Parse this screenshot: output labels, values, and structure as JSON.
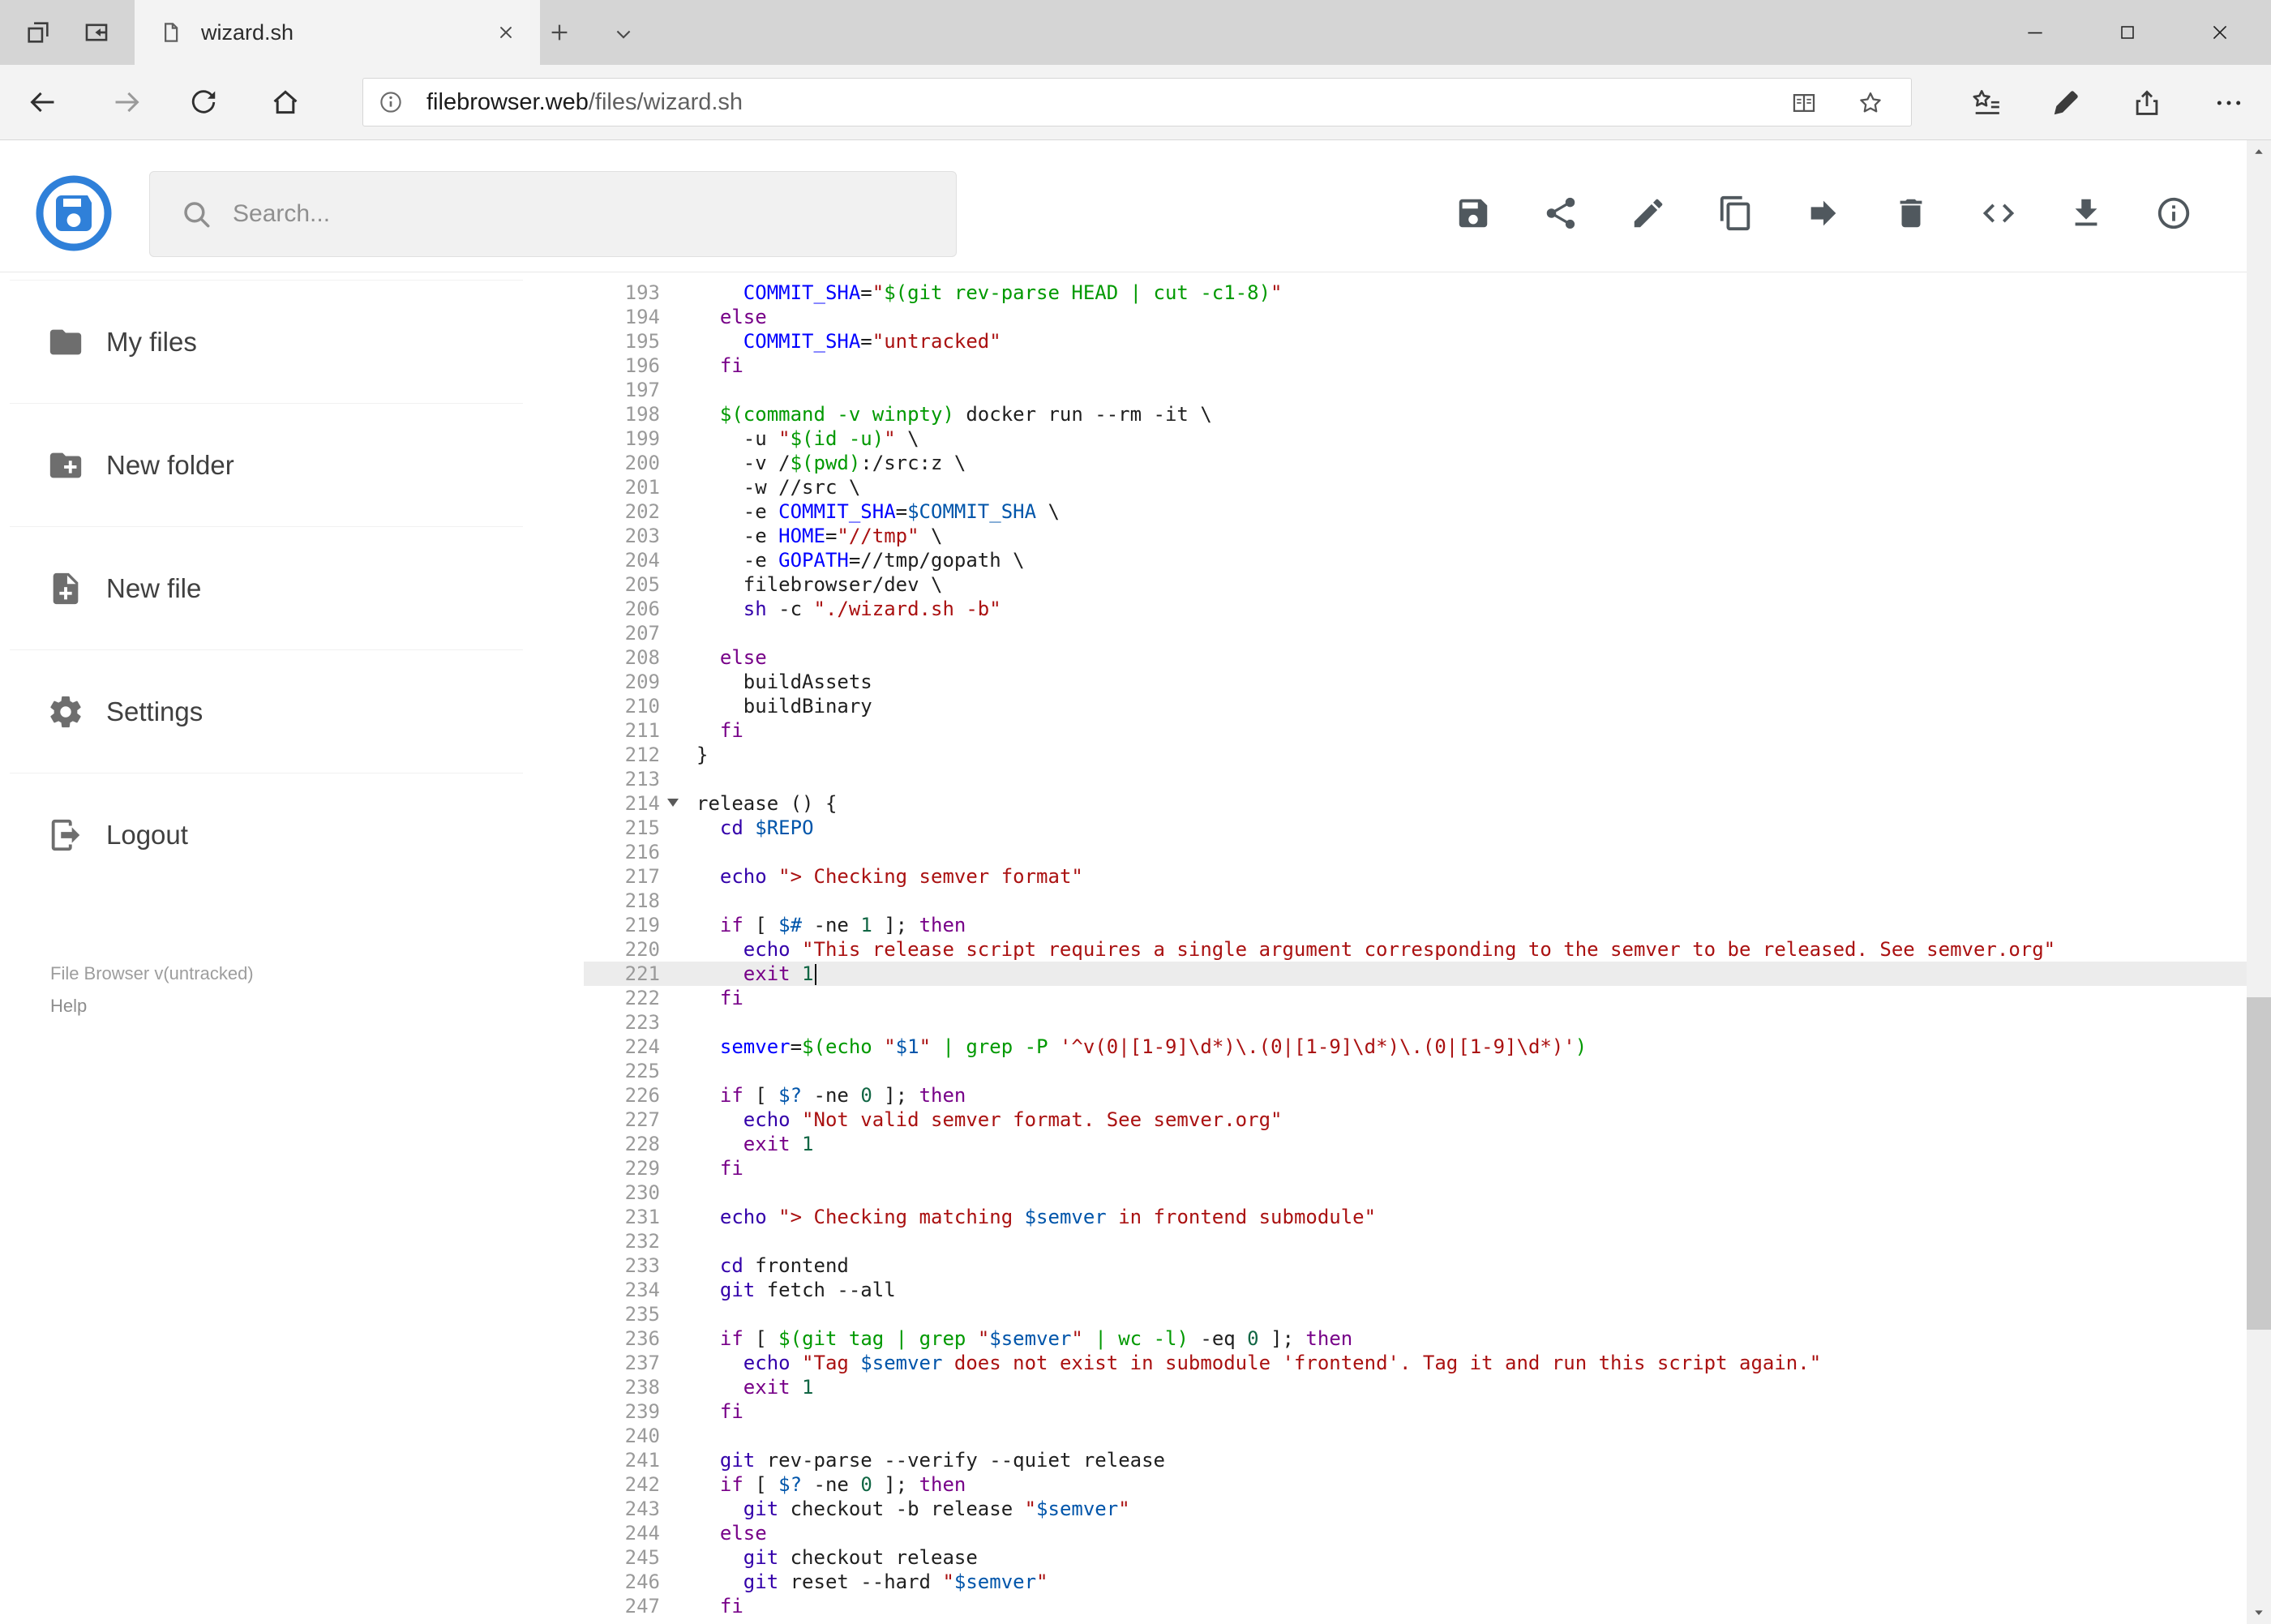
{
  "browser": {
    "tab_title": "wizard.sh",
    "url_domain": "filebrowser.web",
    "url_path": "/files/wizard.sh"
  },
  "header": {
    "search_placeholder": "Search...",
    "actions": [
      {
        "name": "save",
        "icon": "save-icon"
      },
      {
        "name": "share",
        "icon": "share-icon"
      },
      {
        "name": "edit",
        "icon": "edit-icon"
      },
      {
        "name": "copy",
        "icon": "copy-icon"
      },
      {
        "name": "move",
        "icon": "move-icon"
      },
      {
        "name": "delete",
        "icon": "delete-icon"
      },
      {
        "name": "code",
        "icon": "code-icon"
      },
      {
        "name": "download",
        "icon": "download-icon"
      },
      {
        "name": "info",
        "icon": "info-icon"
      }
    ]
  },
  "sidebar": {
    "items": [
      {
        "id": "my-files",
        "label": "My files",
        "icon": "folder-icon"
      },
      {
        "id": "new-folder",
        "label": "New folder",
        "icon": "folder-plus-icon"
      },
      {
        "id": "new-file",
        "label": "New file",
        "icon": "file-plus-icon"
      },
      {
        "id": "settings",
        "label": "Settings",
        "icon": "gear-icon"
      },
      {
        "id": "logout",
        "label": "Logout",
        "icon": "logout-icon"
      }
    ],
    "footer": {
      "version": "File Browser v(untracked)",
      "help": "Help"
    }
  },
  "colors": {
    "accent_blue": "#2f80d9",
    "active_line_bg": "#ececec",
    "syntax": {
      "keyword": "#770088",
      "builtin": "#3300aa",
      "string": "#aa1111",
      "variable": "#0055aa",
      "definition": "#0000ff",
      "quote": "#009900",
      "number": "#116644",
      "plain": "#1f1f1f",
      "line_number": "#9a9a9a"
    }
  },
  "editor": {
    "first_line": 193,
    "active_line": 221,
    "fold_line": 214,
    "lines": [
      {
        "n": 193,
        "t": [
          [
            "p",
            "    "
          ],
          [
            "d",
            "COMMIT_SHA"
          ],
          [
            "p",
            "="
          ],
          [
            "s",
            "\""
          ],
          [
            "q",
            "$(git rev-parse HEAD | cut -c1-8)"
          ],
          [
            "s",
            "\""
          ]
        ]
      },
      {
        "n": 194,
        "t": [
          [
            "p",
            "  "
          ],
          [
            "k",
            "else"
          ]
        ]
      },
      {
        "n": 195,
        "t": [
          [
            "p",
            "    "
          ],
          [
            "d",
            "COMMIT_SHA"
          ],
          [
            "p",
            "="
          ],
          [
            "s",
            "\"untracked\""
          ]
        ]
      },
      {
        "n": 196,
        "t": [
          [
            "p",
            "  "
          ],
          [
            "k",
            "fi"
          ]
        ]
      },
      {
        "n": 197,
        "t": []
      },
      {
        "n": 198,
        "t": [
          [
            "p",
            "  "
          ],
          [
            "q",
            "$(command -v winpty)"
          ],
          [
            "p",
            " docker run --rm -it \\"
          ]
        ]
      },
      {
        "n": 199,
        "t": [
          [
            "p",
            "    -u "
          ],
          [
            "s",
            "\""
          ],
          [
            "q",
            "$(id -u)"
          ],
          [
            "s",
            "\""
          ],
          [
            "p",
            " \\"
          ]
        ]
      },
      {
        "n": 200,
        "t": [
          [
            "p",
            "    -v /"
          ],
          [
            "q",
            "$(pwd)"
          ],
          [
            "p",
            ":/src:z \\"
          ]
        ]
      },
      {
        "n": 201,
        "t": [
          [
            "p",
            "    -w //src \\"
          ]
        ]
      },
      {
        "n": 202,
        "t": [
          [
            "p",
            "    -e "
          ],
          [
            "d",
            "COMMIT_SHA"
          ],
          [
            "p",
            "="
          ],
          [
            "v",
            "$COMMIT_SHA"
          ],
          [
            "p",
            " \\"
          ]
        ]
      },
      {
        "n": 203,
        "t": [
          [
            "p",
            "    -e "
          ],
          [
            "d",
            "HOME"
          ],
          [
            "p",
            "="
          ],
          [
            "s",
            "\"//tmp\""
          ],
          [
            "p",
            " \\"
          ]
        ]
      },
      {
        "n": 204,
        "t": [
          [
            "p",
            "    -e "
          ],
          [
            "d",
            "GOPATH"
          ],
          [
            "p",
            "=//tmp/gopath \\"
          ]
        ]
      },
      {
        "n": 205,
        "t": [
          [
            "p",
            "    filebrowser/dev \\"
          ]
        ]
      },
      {
        "n": 206,
        "t": [
          [
            "p",
            "    "
          ],
          [
            "b",
            "sh"
          ],
          [
            "p",
            " -c "
          ],
          [
            "s",
            "\"./wizard.sh -b\""
          ]
        ]
      },
      {
        "n": 207,
        "t": []
      },
      {
        "n": 208,
        "t": [
          [
            "p",
            "  "
          ],
          [
            "k",
            "else"
          ]
        ]
      },
      {
        "n": 209,
        "t": [
          [
            "p",
            "    buildAssets"
          ]
        ]
      },
      {
        "n": 210,
        "t": [
          [
            "p",
            "    buildBinary"
          ]
        ]
      },
      {
        "n": 211,
        "t": [
          [
            "p",
            "  "
          ],
          [
            "k",
            "fi"
          ]
        ]
      },
      {
        "n": 212,
        "t": [
          [
            "p",
            "}"
          ]
        ]
      },
      {
        "n": 213,
        "t": []
      },
      {
        "n": 214,
        "t": [
          [
            "p",
            "release () {"
          ]
        ]
      },
      {
        "n": 215,
        "t": [
          [
            "p",
            "  "
          ],
          [
            "b",
            "cd"
          ],
          [
            "p",
            " "
          ],
          [
            "v",
            "$REPO"
          ]
        ]
      },
      {
        "n": 216,
        "t": []
      },
      {
        "n": 217,
        "t": [
          [
            "p",
            "  "
          ],
          [
            "b",
            "echo"
          ],
          [
            "p",
            " "
          ],
          [
            "s",
            "\"> Checking semver format\""
          ]
        ]
      },
      {
        "n": 218,
        "t": []
      },
      {
        "n": 219,
        "t": [
          [
            "p",
            "  "
          ],
          [
            "k",
            "if"
          ],
          [
            "p",
            " [ "
          ],
          [
            "v",
            "$#"
          ],
          [
            "p",
            " -ne "
          ],
          [
            "n",
            "1"
          ],
          [
            "p",
            " ]; "
          ],
          [
            "k",
            "then"
          ]
        ]
      },
      {
        "n": 220,
        "t": [
          [
            "p",
            "    "
          ],
          [
            "b",
            "echo"
          ],
          [
            "p",
            " "
          ],
          [
            "s",
            "\"This release script requires a single argument corresponding to the semver to be released. See semver.org\""
          ]
        ]
      },
      {
        "n": 221,
        "t": [
          [
            "p",
            "    "
          ],
          [
            "k",
            "exit"
          ],
          [
            "p",
            " "
          ],
          [
            "n",
            "1"
          ],
          [
            "cursor",
            ""
          ]
        ]
      },
      {
        "n": 222,
        "t": [
          [
            "p",
            "  "
          ],
          [
            "k",
            "fi"
          ]
        ]
      },
      {
        "n": 223,
        "t": []
      },
      {
        "n": 224,
        "t": [
          [
            "p",
            "  "
          ],
          [
            "d",
            "semver"
          ],
          [
            "p",
            "="
          ],
          [
            "q",
            "$(echo "
          ],
          [
            "s",
            "\""
          ],
          [
            "v",
            "$1"
          ],
          [
            "s",
            "\""
          ],
          [
            "q",
            " | grep -P "
          ],
          [
            "s",
            "'^v(0|[1-9]\\d*)\\.(0|[1-9]\\d*)\\.(0|[1-9]\\d*)'"
          ],
          [
            "q",
            ")"
          ]
        ]
      },
      {
        "n": 225,
        "t": []
      },
      {
        "n": 226,
        "t": [
          [
            "p",
            "  "
          ],
          [
            "k",
            "if"
          ],
          [
            "p",
            " [ "
          ],
          [
            "v",
            "$?"
          ],
          [
            "p",
            " -ne "
          ],
          [
            "n",
            "0"
          ],
          [
            "p",
            " ]; "
          ],
          [
            "k",
            "then"
          ]
        ]
      },
      {
        "n": 227,
        "t": [
          [
            "p",
            "    "
          ],
          [
            "b",
            "echo"
          ],
          [
            "p",
            " "
          ],
          [
            "s",
            "\"Not valid semver format. See semver.org\""
          ]
        ]
      },
      {
        "n": 228,
        "t": [
          [
            "p",
            "    "
          ],
          [
            "k",
            "exit"
          ],
          [
            "p",
            " "
          ],
          [
            "n",
            "1"
          ]
        ]
      },
      {
        "n": 229,
        "t": [
          [
            "p",
            "  "
          ],
          [
            "k",
            "fi"
          ]
        ]
      },
      {
        "n": 230,
        "t": []
      },
      {
        "n": 231,
        "t": [
          [
            "p",
            "  "
          ],
          [
            "b",
            "echo"
          ],
          [
            "p",
            " "
          ],
          [
            "s",
            "\"> Checking matching "
          ],
          [
            "v",
            "$semver"
          ],
          [
            "s",
            " in frontend submodule\""
          ]
        ]
      },
      {
        "n": 232,
        "t": []
      },
      {
        "n": 233,
        "t": [
          [
            "p",
            "  "
          ],
          [
            "b",
            "cd"
          ],
          [
            "p",
            " frontend"
          ]
        ]
      },
      {
        "n": 234,
        "t": [
          [
            "p",
            "  "
          ],
          [
            "b",
            "git"
          ],
          [
            "p",
            " fetch --all"
          ]
        ]
      },
      {
        "n": 235,
        "t": []
      },
      {
        "n": 236,
        "t": [
          [
            "p",
            "  "
          ],
          [
            "k",
            "if"
          ],
          [
            "p",
            " [ "
          ],
          [
            "q",
            "$(git tag | grep "
          ],
          [
            "s",
            "\""
          ],
          [
            "v",
            "$semver"
          ],
          [
            "s",
            "\""
          ],
          [
            "q",
            " | wc -l)"
          ],
          [
            "p",
            " -eq "
          ],
          [
            "n",
            "0"
          ],
          [
            "p",
            " ]; "
          ],
          [
            "k",
            "then"
          ]
        ]
      },
      {
        "n": 237,
        "t": [
          [
            "p",
            "    "
          ],
          [
            "b",
            "echo"
          ],
          [
            "p",
            " "
          ],
          [
            "s",
            "\"Tag "
          ],
          [
            "v",
            "$semver"
          ],
          [
            "s",
            " does not exist in submodule 'frontend'. Tag it and run this script again.\""
          ]
        ]
      },
      {
        "n": 238,
        "t": [
          [
            "p",
            "    "
          ],
          [
            "k",
            "exit"
          ],
          [
            "p",
            " "
          ],
          [
            "n",
            "1"
          ]
        ]
      },
      {
        "n": 239,
        "t": [
          [
            "p",
            "  "
          ],
          [
            "k",
            "fi"
          ]
        ]
      },
      {
        "n": 240,
        "t": []
      },
      {
        "n": 241,
        "t": [
          [
            "p",
            "  "
          ],
          [
            "b",
            "git"
          ],
          [
            "p",
            " rev-parse --verify --quiet release"
          ]
        ]
      },
      {
        "n": 242,
        "t": [
          [
            "p",
            "  "
          ],
          [
            "k",
            "if"
          ],
          [
            "p",
            " [ "
          ],
          [
            "v",
            "$?"
          ],
          [
            "p",
            " -ne "
          ],
          [
            "n",
            "0"
          ],
          [
            "p",
            " ]; "
          ],
          [
            "k",
            "then"
          ]
        ]
      },
      {
        "n": 243,
        "t": [
          [
            "p",
            "    "
          ],
          [
            "b",
            "git"
          ],
          [
            "p",
            " checkout -b release "
          ],
          [
            "s",
            "\""
          ],
          [
            "v",
            "$semver"
          ],
          [
            "s",
            "\""
          ]
        ]
      },
      {
        "n": 244,
        "t": [
          [
            "p",
            "  "
          ],
          [
            "k",
            "else"
          ]
        ]
      },
      {
        "n": 245,
        "t": [
          [
            "p",
            "    "
          ],
          [
            "b",
            "git"
          ],
          [
            "p",
            " checkout release"
          ]
        ]
      },
      {
        "n": 246,
        "t": [
          [
            "p",
            "    "
          ],
          [
            "b",
            "git"
          ],
          [
            "p",
            " reset --hard "
          ],
          [
            "s",
            "\""
          ],
          [
            "v",
            "$semver"
          ],
          [
            "s",
            "\""
          ]
        ]
      },
      {
        "n": 247,
        "t": [
          [
            "p",
            "  "
          ],
          [
            "k",
            "fi"
          ]
        ]
      }
    ]
  }
}
